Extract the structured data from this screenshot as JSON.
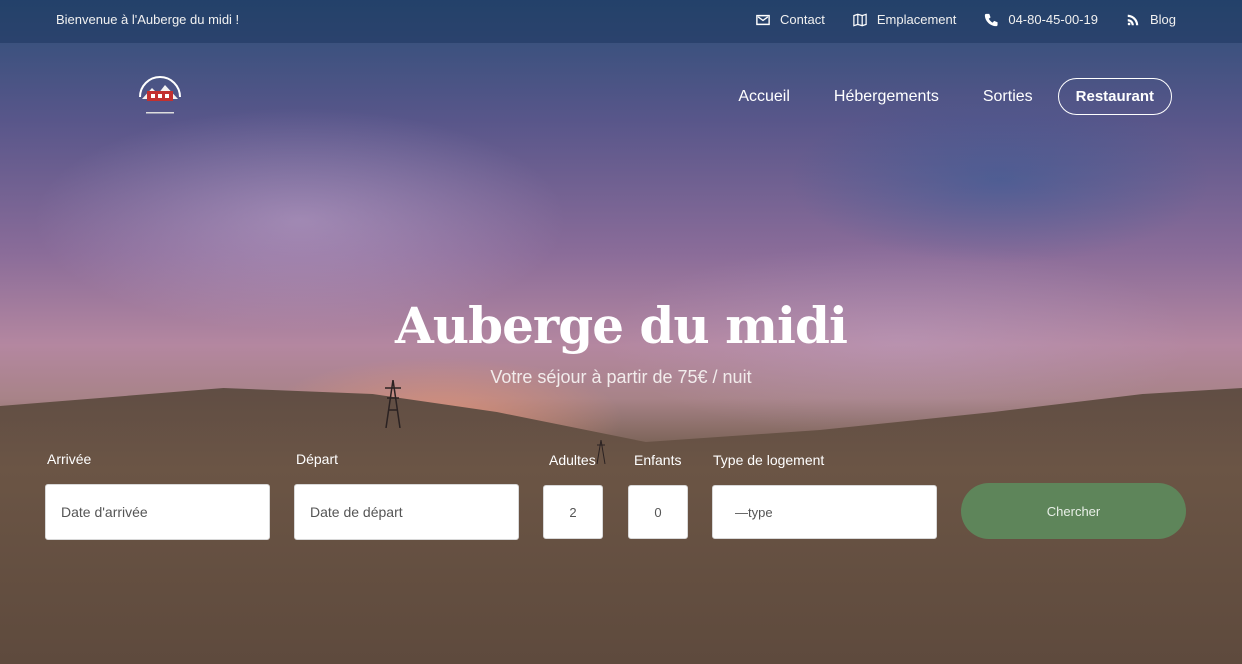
{
  "topbar": {
    "welcome": "Bienvenue à l'Auberge du midi !",
    "links": [
      {
        "label": "Contact",
        "icon": "envelope-icon"
      },
      {
        "label": "Emplacement",
        "icon": "map-icon"
      },
      {
        "label": "04-80-45-00-19",
        "icon": "phone-icon"
      },
      {
        "label": "Blog",
        "icon": "blog-feed-icon"
      }
    ]
  },
  "nav": {
    "items": [
      "Accueil",
      "Hébergements",
      "Sorties"
    ],
    "cta": "Restaurant"
  },
  "hero": {
    "title": "Auberge du midi",
    "subtitle": "Votre séjour à partir de 75€ / nuit"
  },
  "booking": {
    "arrival_label": "Arrivée",
    "arrival_placeholder": "Date d'arrivée",
    "departure_label": "Départ",
    "departure_placeholder": "Date de départ",
    "adults_label": "Adultes",
    "adults_value": "2",
    "children_label": "Enfants",
    "children_value": "0",
    "type_label": "Type de logement",
    "type_value": "—type",
    "search_label": "Chercher"
  },
  "colors": {
    "search_button": "#5e855a",
    "topbar": "#1e375f"
  }
}
